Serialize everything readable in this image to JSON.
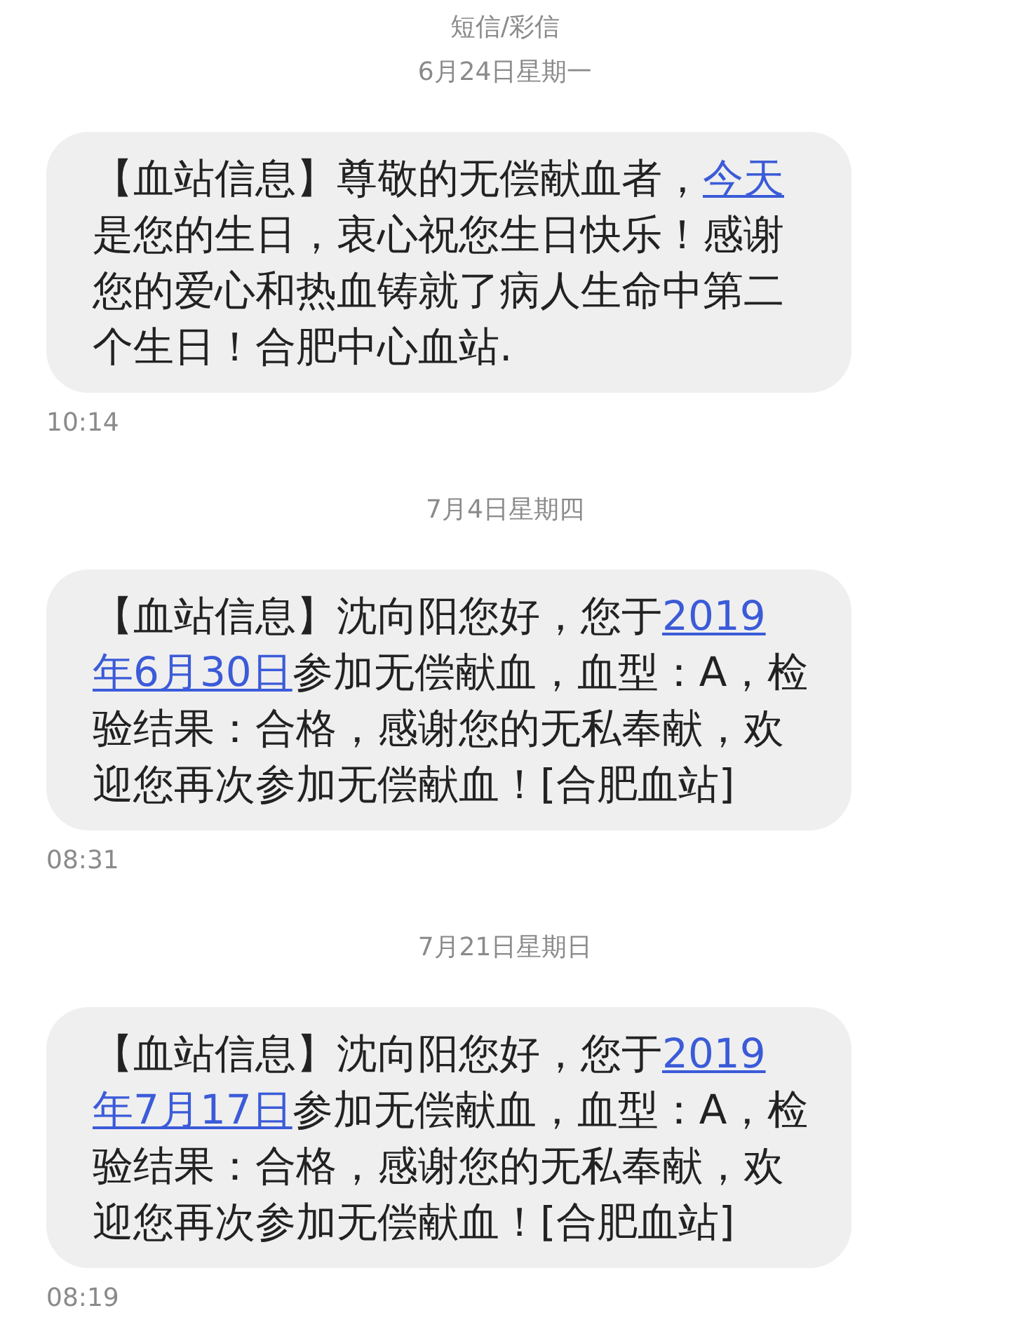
{
  "header": {
    "title": "短信/彩信"
  },
  "messages": [
    {
      "date": "6月24日星期一",
      "parts": [
        {
          "kind": "text",
          "text": "【血站信息】尊敬的无偿献血者，"
        },
        {
          "kind": "link",
          "text": "今天"
        },
        {
          "kind": "text",
          "text": "是您的生日，衷心祝您生日快乐！感谢您的爱心和热血铸就了病人生命中第二个生日！合肥中心血站."
        }
      ],
      "time": "10:14"
    },
    {
      "date": "7月4日星期四",
      "parts": [
        {
          "kind": "text",
          "text": "【血站信息】沈向阳您好，您于"
        },
        {
          "kind": "link",
          "text": "2019"
        },
        {
          "kind": "link",
          "text": "年6月30日"
        },
        {
          "kind": "text",
          "text": "参加无偿献血，血型：A，检验结果：合格，感谢您的无私奉献，欢迎您再次参加无偿献血！[合肥血站]"
        }
      ],
      "time": "08:31"
    },
    {
      "date": "7月21日星期日",
      "parts": [
        {
          "kind": "text",
          "text": "【血站信息】沈向阳您好，您于"
        },
        {
          "kind": "link",
          "text": "2019"
        },
        {
          "kind": "link",
          "text": "年7月17日"
        },
        {
          "kind": "text",
          "text": "参加无偿献血，血型：A，检验结果：合格，感谢您的无私奉献，欢迎您再次参加无偿献血！[合肥血站]"
        }
      ],
      "time": "08:19"
    }
  ]
}
